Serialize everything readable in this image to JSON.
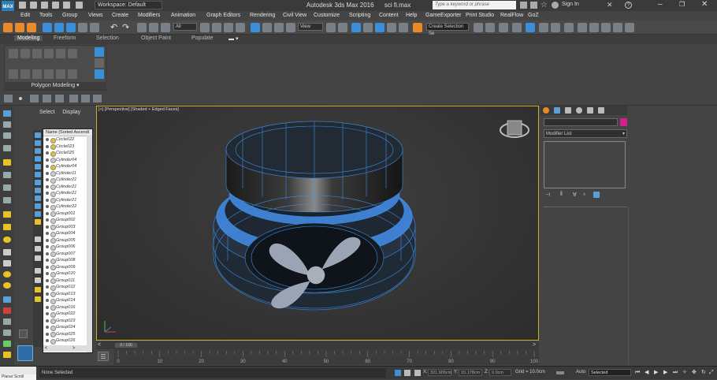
{
  "title_bar": {
    "logo_text": "MAX",
    "workspace": "Workspace: Default",
    "app_name": "Autodesk 3ds Max 2016",
    "file_name": "sci fi.max",
    "search_placeholder": "Type a keyword or phrase",
    "sign_in": "Sign In"
  },
  "menu": [
    "Edit",
    "Tools",
    "Group",
    "Views",
    "Create",
    "Modifiers",
    "Animation",
    "Graph Editors",
    "Rendering",
    "Civil View",
    "Customize",
    "Scripting",
    "Content",
    "Help",
    "GameExporter",
    "Print Studio",
    "RealFlow",
    "GoZ"
  ],
  "toolbar": {
    "filter_value": "All",
    "view_value": "View",
    "selection_set": "Create Selection Se"
  },
  "ribbon": {
    "tabs": [
      "Modeling",
      "Freeform",
      "Selection",
      "Object Paint",
      "Populate"
    ],
    "active_tab": "Modeling",
    "panel_label": "Polygon Modeling"
  },
  "explorer": {
    "tabs": [
      "Select",
      "Display"
    ],
    "header": "Name (Sorted Ascendi",
    "rows": [
      {
        "name": "Circle022",
        "icon": "bulb"
      },
      {
        "name": "Circle023",
        "icon": "bulb"
      },
      {
        "name": "Circle025",
        "icon": "bulb"
      },
      {
        "name": "Cylinder04",
        "icon": "sphere"
      },
      {
        "name": "Cylinder04",
        "icon": "bulb"
      },
      {
        "name": "Cylinder11",
        "icon": "sphere"
      },
      {
        "name": "Cylinder21",
        "icon": "sphere"
      },
      {
        "name": "Cylinder21",
        "icon": "sphere"
      },
      {
        "name": "Cylinder21",
        "icon": "sphere"
      },
      {
        "name": "Cylinder21",
        "icon": "sphere"
      },
      {
        "name": "Cylinder22",
        "icon": "sphere"
      },
      {
        "name": "Group001",
        "icon": "group"
      },
      {
        "name": "Group002",
        "icon": "group"
      },
      {
        "name": "Group003",
        "icon": "group"
      },
      {
        "name": "Group004",
        "icon": "group"
      },
      {
        "name": "Group005",
        "icon": "group"
      },
      {
        "name": "Group006",
        "icon": "group"
      },
      {
        "name": "Group007",
        "icon": "group"
      },
      {
        "name": "Group008",
        "icon": "group"
      },
      {
        "name": "Group009",
        "icon": "group"
      },
      {
        "name": "Group010",
        "icon": "group"
      },
      {
        "name": "Group011",
        "icon": "group"
      },
      {
        "name": "Group012",
        "icon": "group"
      },
      {
        "name": "Group013",
        "icon": "group"
      },
      {
        "name": "Group014",
        "icon": "group"
      },
      {
        "name": "Group016",
        "icon": "group"
      },
      {
        "name": "Group022",
        "icon": "group"
      },
      {
        "name": "Group023",
        "icon": "group"
      },
      {
        "name": "Group024",
        "icon": "group"
      },
      {
        "name": "Group025",
        "icon": "group"
      },
      {
        "name": "Group026",
        "icon": "group"
      },
      {
        "name": "Group027",
        "icon": "group"
      }
    ]
  },
  "viewport": {
    "label": "[+] [Perspective] [Shaded + Edged Faces]",
    "border_color": "#c8b02c",
    "wire_color": "#3f8de0"
  },
  "command_panel": {
    "modifier_list": "Modifier List",
    "object_color": "#d0218a"
  },
  "timeline": {
    "frame_display": "0 / 100",
    "ticks": [
      "0",
      "10",
      "20",
      "30",
      "40",
      "50",
      "60",
      "70",
      "80",
      "90",
      "100"
    ]
  },
  "status": {
    "selection": "None Selected",
    "x_label": "X:",
    "x_value": "321.906cm",
    "y_label": "Y:",
    "y_value": "15.178cm",
    "z_label": "Z:",
    "z_value": "0.0cm",
    "grid": "Grid = 10.0cm",
    "auto": "Auto",
    "set_key_filter": "Selected",
    "left_hint": "Planar Scroll"
  }
}
